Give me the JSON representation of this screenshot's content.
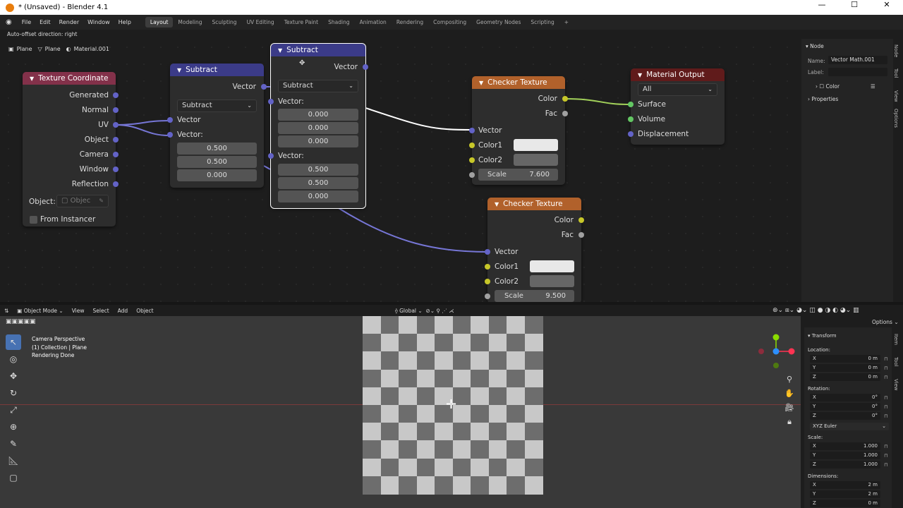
{
  "window": {
    "title": "* (Unsaved) - Blender 4.1"
  },
  "menus": [
    "File",
    "Edit",
    "Render",
    "Window",
    "Help"
  ],
  "workspaces": [
    "Layout",
    "Modeling",
    "Sculpting",
    "UV Editing",
    "Texture Paint",
    "Shading",
    "Animation",
    "Rendering",
    "Compositing",
    "Geometry Nodes",
    "Scripting"
  ],
  "workspace_add": "+",
  "hint": "Auto-offset direction: right",
  "breadcrumb": [
    "Plane",
    "Plane",
    "Material.001"
  ],
  "nodes": {
    "texcoord": {
      "title": "Texture Coordinate",
      "outputs": [
        "Generated",
        "Normal",
        "UV",
        "Object",
        "Camera",
        "Window",
        "Reflection"
      ],
      "object_label": "Object:",
      "object_placeholder": "Objec",
      "from_instancer": "From Instancer"
    },
    "sub1": {
      "title": "Subtract",
      "out": "Vector",
      "op": "Subtract",
      "in1": "Vector",
      "in2": "Vector:",
      "v2": [
        "0.500",
        "0.500",
        "0.000"
      ]
    },
    "sub2": {
      "title": "Subtract",
      "out": "Vector",
      "op": "Subtract",
      "in1": "Vector:",
      "v1": [
        "0.000",
        "0.000",
        "0.000"
      ],
      "in2": "Vector:",
      "v2": [
        "0.500",
        "0.500",
        "0.000"
      ]
    },
    "check1": {
      "title": "Checker Texture",
      "out_color": "Color",
      "out_fac": "Fac",
      "in_vec": "Vector",
      "c1": "Color1",
      "c2": "Color2",
      "scale_label": "Scale",
      "scale": "7.600"
    },
    "check2": {
      "title": "Checker Texture",
      "out_color": "Color",
      "out_fac": "Fac",
      "in_vec": "Vector",
      "c1": "Color1",
      "c2": "Color2",
      "scale_label": "Scale",
      "scale": "9.500"
    },
    "output": {
      "title": "Material Output",
      "target": "All",
      "inputs": [
        "Surface",
        "Volume",
        "Displacement"
      ]
    }
  },
  "node_sidebar": {
    "section": "Node",
    "name_label": "Name:",
    "name": "Vector Math.001",
    "label_label": "Label:",
    "color": "Color",
    "properties": "Properties",
    "tabs": [
      "Node",
      "Tool",
      "View",
      "Options"
    ]
  },
  "viewport_header": {
    "mode": "Object Mode",
    "menus": [
      "View",
      "Select",
      "Add",
      "Object"
    ],
    "transform": "Global",
    "options": "Options"
  },
  "viewport_info": [
    "Camera Perspective",
    "(1) Collection | Plane",
    "Rendering Done"
  ],
  "transform_panel": {
    "title": "Transform",
    "location_label": "Location:",
    "location": [
      [
        "X",
        "0 m"
      ],
      [
        "Y",
        "0 m"
      ],
      [
        "Z",
        "0 m"
      ]
    ],
    "rotation_label": "Rotation:",
    "rotation": [
      [
        "X",
        "0°"
      ],
      [
        "Y",
        "0°"
      ],
      [
        "Z",
        "0°"
      ]
    ],
    "rotation_mode": "XYZ Euler",
    "scale_label": "Scale:",
    "scale": [
      [
        "X",
        "1.000"
      ],
      [
        "Y",
        "1.000"
      ],
      [
        "Z",
        "1.000"
      ]
    ],
    "dimensions_label": "Dimensions:",
    "dimensions": [
      [
        "X",
        "2 m"
      ],
      [
        "Y",
        "2 m"
      ],
      [
        "Z",
        "0 m"
      ]
    ],
    "tabs": [
      "Item",
      "Tool",
      "View"
    ]
  },
  "colors": {
    "accent": "#4772b3",
    "vector_socket": "#6363c7",
    "color_socket": "#c7c729",
    "shader_socket": "#63c763",
    "checker_light": "#c8c8c8",
    "checker_dark": "#6d6d6d"
  }
}
